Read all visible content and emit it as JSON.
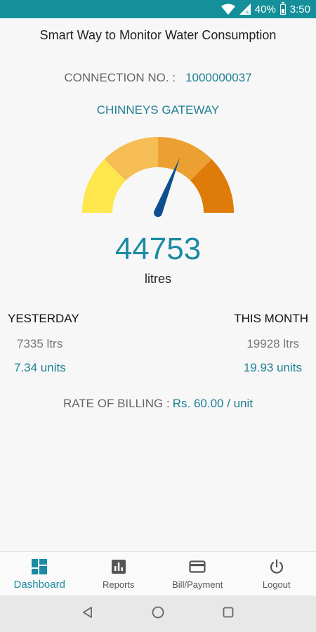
{
  "status_bar": {
    "battery": "40%",
    "time": "3:50",
    "color": "#15909a"
  },
  "header": {
    "title": "Smart Way to Monitor Water Consumption"
  },
  "connection": {
    "label": "CONNECTION NO. :",
    "number": "1000000037"
  },
  "gateway": "CHINNEYS GATEWAY",
  "gauge": {
    "needle_fraction": 0.62,
    "segment_colors": [
      "#fde74c",
      "#f6bd54",
      "#eda032",
      "#df7b09"
    ],
    "needle_color": "#0d4f8f"
  },
  "reading": {
    "value": "44753",
    "unit": "litres"
  },
  "yesterday": {
    "label": "YESTERDAY",
    "litres": "7335 ltrs",
    "units": "7.34 units"
  },
  "this_month": {
    "label": "THIS MONTH",
    "litres": "19928 ltrs",
    "units": "19.93 units"
  },
  "billing": {
    "label": "RATE OF BILLING :",
    "value": "Rs. 60.00 / unit"
  },
  "bottom_nav": {
    "items": [
      {
        "label": "Dashboard",
        "icon": "dashboard-icon",
        "active": true
      },
      {
        "label": "Reports",
        "icon": "bar-chart-icon",
        "active": false
      },
      {
        "label": "Bill/Payment",
        "icon": "credit-card-icon",
        "active": false
      },
      {
        "label": "Logout",
        "icon": "power-icon",
        "active": false
      }
    ],
    "active_color": "#1b8aa3"
  },
  "system_nav": {
    "icons": [
      "back-icon",
      "home-icon",
      "recents-icon"
    ]
  }
}
